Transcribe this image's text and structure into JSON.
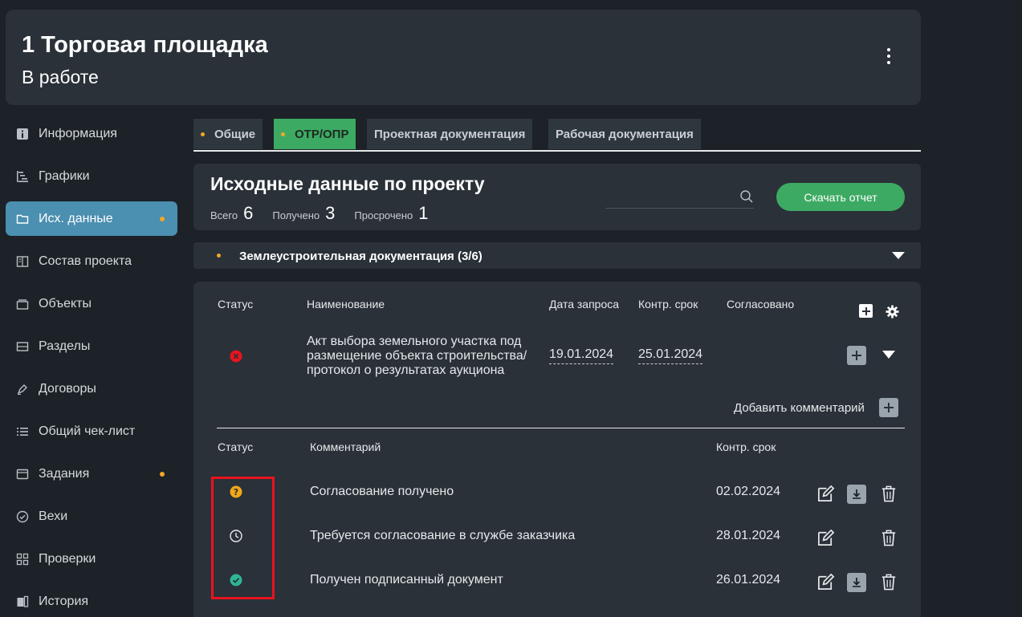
{
  "header": {
    "title": "1 Торговая площадка",
    "status": "В работе",
    "menu_icon": "kebab-menu-icon"
  },
  "sidebar": {
    "items": [
      {
        "label": "Информация",
        "icon": "info-icon"
      },
      {
        "label": "Графики",
        "icon": "gantt-icon"
      },
      {
        "label": "Исх. данные",
        "icon": "folder-icon",
        "active": true,
        "dot": true
      },
      {
        "label": "Состав проекта",
        "icon": "book-icon"
      },
      {
        "label": "Объекты",
        "icon": "layers-icon"
      },
      {
        "label": "Разделы",
        "icon": "sections-icon"
      },
      {
        "label": "Договоры",
        "icon": "pen-icon"
      },
      {
        "label": "Общий чек-лист",
        "icon": "list-icon"
      },
      {
        "label": "Задания",
        "icon": "tasks-icon",
        "dot": true
      },
      {
        "label": "Вехи",
        "icon": "milestone-check-icon"
      },
      {
        "label": "Проверки",
        "icon": "grid-icon"
      },
      {
        "label": "История",
        "icon": "history-icon"
      }
    ]
  },
  "tabs": [
    {
      "label": "Общие",
      "dot": true
    },
    {
      "label": "ОТР/ОПР",
      "dot": true,
      "active": true
    },
    {
      "label": "Проектная документация"
    },
    {
      "label": "Рабочая документация"
    }
  ],
  "summary": {
    "title": "Исходные данные по проекту",
    "total_label": "Всего",
    "total": "6",
    "received_label": "Получено",
    "received": "3",
    "overdue_label": "Просрочено",
    "overdue": "1",
    "search_placeholder": "",
    "download_label": "Скачать отчет"
  },
  "group": {
    "title": "Землеустроительная документация (3/6)"
  },
  "table": {
    "headers": {
      "status": "Статус",
      "name": "Наименование",
      "request_date": "Дата запроса",
      "deadline": "Контр. срок",
      "approved": "Согласовано"
    },
    "row": {
      "status_icon": "error-circle-icon",
      "name": "Акт выбора земельного участка под размещение объекта строительства/протокол о результатах аукциона",
      "name_lines": [
        "Акт выбора земельного участка под",
        "размещение объекта строительства/",
        "протокол о результатах аукциона"
      ],
      "request_date": "19.01.2024",
      "deadline": "25.01.2024",
      "approved": ""
    },
    "add_comment_label": "Добавить комментарий"
  },
  "comments": {
    "headers": {
      "status": "Статус",
      "comment": "Комментарий",
      "deadline": "Контр. срок"
    },
    "rows": [
      {
        "status_icon": "question-circle-icon",
        "text": "Согласование получено",
        "deadline": "02.02.2024",
        "download": true
      },
      {
        "status_icon": "clock-icon",
        "text": "Требуется согласование в службе заказчика",
        "deadline": "28.01.2024",
        "download": false
      },
      {
        "status_icon": "check-circle-icon",
        "text": "Получен подписанный документ",
        "deadline": "26.01.2024",
        "download": true
      }
    ]
  },
  "colors": {
    "accent_green": "#3daa63",
    "active_nav": "#4b8fb1",
    "dot_orange": "#f5a623",
    "error_red": "#e8141e",
    "question_yellow": "#f0a818",
    "check_teal": "#2fb595",
    "highlight_box": "#e8141e"
  }
}
